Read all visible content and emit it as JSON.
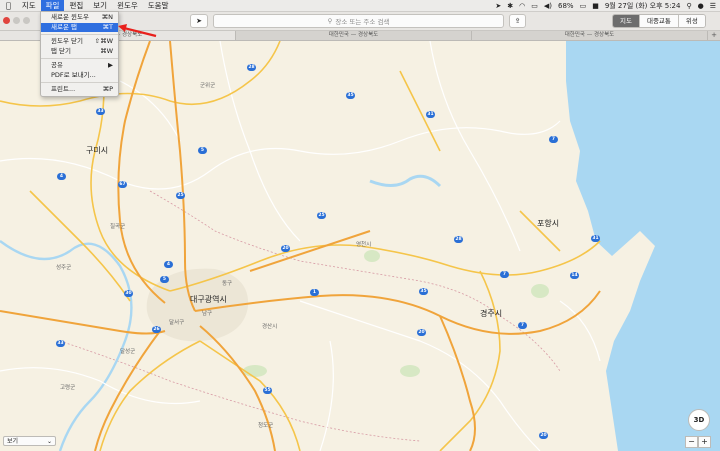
{
  "menubar": {
    "apple": "",
    "items": [
      "지도",
      "파일",
      "편집",
      "보기",
      "윈도우",
      "도움말"
    ],
    "clock": "9월 27일 (화) 오후 5:24",
    "battery": "68%"
  },
  "file_menu": {
    "items": [
      {
        "label": "새로운 윈도우",
        "shortcut": "⌘N"
      },
      {
        "label": "새로운 탭",
        "shortcut": "⌘T"
      },
      {
        "label": "윈도우 닫기",
        "shortcut": "⇧⌘W"
      },
      {
        "label": "탭 닫기",
        "shortcut": "⌘W"
      },
      {
        "label": "공유",
        "shortcut": "▶"
      },
      {
        "label": "PDF로 보내기...",
        "shortcut": ""
      },
      {
        "label": "프린트...",
        "shortcut": "⌘P"
      }
    ]
  },
  "toolbar": {
    "search_placeholder": "장소 또는 주소 검색",
    "view_modes": [
      "지도",
      "대중교통",
      "위성"
    ]
  },
  "tabs": [
    "대한민국 — 경상북도",
    "대한민국 — 경상북도",
    "대한민국 — 경상북도"
  ],
  "map": {
    "places": {
      "gumi": "구미시",
      "daegu": "대구광역시",
      "pohang": "포항시",
      "gyeongju": "경주시",
      "chilgok": "칠곡군",
      "seongju": "성주군",
      "goryeong": "고령군",
      "yeongcheon": "영천시",
      "gyeongsan": "경산시",
      "dalseong": "달성군",
      "dalseo": "달서구",
      "namgu": "남구",
      "donggu": "동구",
      "cheongdo": "청도군",
      "gunwi": "군위군"
    },
    "shields": [
      "33",
      "28",
      "35",
      "5",
      "4",
      "67",
      "25",
      "4",
      "20",
      "26",
      "33",
      "5",
      "30",
      "25",
      "31",
      "7",
      "28",
      "7",
      "35",
      "20",
      "1",
      "14",
      "7",
      "31",
      "55",
      "20"
    ]
  },
  "bottom": {
    "view_select": "보기",
    "btn_3d": "3D",
    "zoom_out": "−",
    "zoom_in": "+"
  }
}
